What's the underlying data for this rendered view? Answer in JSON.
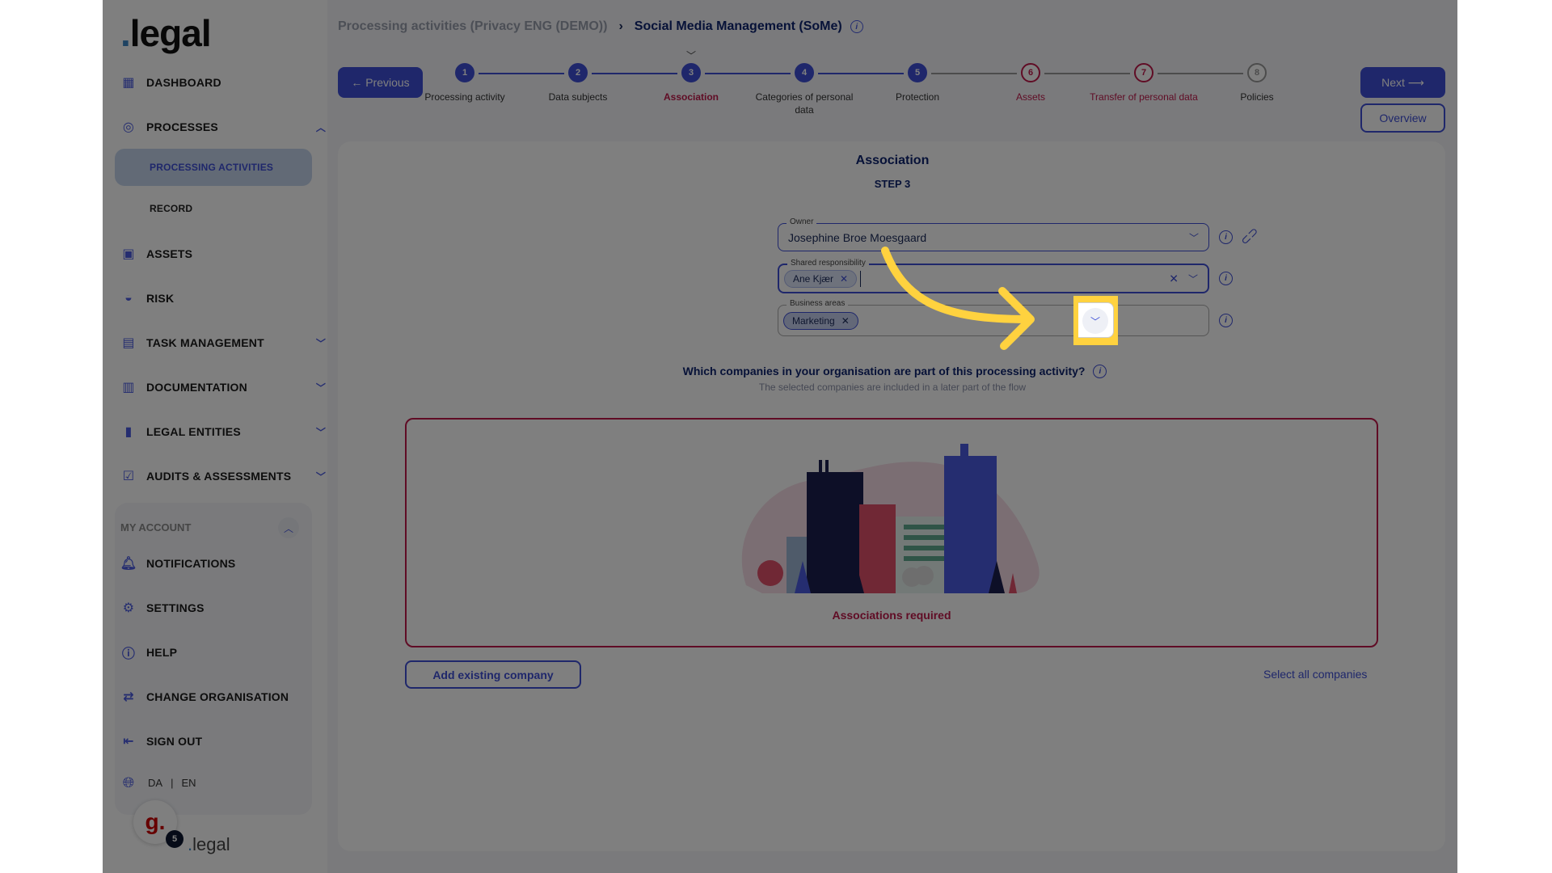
{
  "sidebar": {
    "logo": "legal",
    "items": [
      {
        "label": "DASHBOARD",
        "icon": "dashboard-icon"
      },
      {
        "label": "PROCESSES",
        "icon": "processes-icon",
        "expanded": true
      },
      {
        "label": "ASSETS",
        "icon": "assets-icon"
      },
      {
        "label": "RISK",
        "icon": "gauge-icon"
      },
      {
        "label": "TASK MANAGEMENT",
        "icon": "calendar-edit-icon",
        "expanded": false
      },
      {
        "label": "DOCUMENTATION",
        "icon": "document-upload-icon",
        "expanded": false
      },
      {
        "label": "LEGAL ENTITIES",
        "icon": "buildings-icon",
        "expanded": false
      },
      {
        "label": "AUDITS & ASSESSMENTS",
        "icon": "checklist-icon",
        "expanded": false
      }
    ],
    "sub_items": [
      {
        "label": "PROCESSING ACTIVITIES",
        "active": true
      },
      {
        "label": "RECORD",
        "active": false
      }
    ],
    "account": {
      "title": "MY ACCOUNT",
      "items": [
        {
          "label": "NOTIFICATIONS",
          "icon": "bell-icon"
        },
        {
          "label": "SETTINGS",
          "icon": "gear-icon"
        },
        {
          "label": "HELP",
          "icon": "help-icon"
        },
        {
          "label": "CHANGE ORGANISATION",
          "icon": "switch-icon"
        },
        {
          "label": "SIGN OUT",
          "icon": "sign-out-icon"
        }
      ],
      "lang_da": "DA",
      "lang_sep": "|",
      "lang_en": "EN"
    },
    "g_badge": "g.",
    "g_count": "5",
    "footer_logo": "legal"
  },
  "header": {
    "breadcrumb_parent": "Processing activities (Privacy ENG (DEMO))",
    "breadcrumb_sep": "›",
    "breadcrumb_current": "Social Media Management (SoMe)",
    "prev_label": "← Previous",
    "next_label": "Next ⟶",
    "overview_label": "Overview"
  },
  "stepper": {
    "steps": [
      {
        "num": "1",
        "label": "Processing activity",
        "state": "done"
      },
      {
        "num": "2",
        "label": "Data subjects",
        "state": "done"
      },
      {
        "num": "3",
        "label": "Association",
        "state": "current"
      },
      {
        "num": "4",
        "label": "Categories of personal data",
        "state": "done"
      },
      {
        "num": "5",
        "label": "Protection",
        "state": "done"
      },
      {
        "num": "6",
        "label": "Assets",
        "state": "error"
      },
      {
        "num": "7",
        "label": "Transfer of personal data",
        "state": "error"
      },
      {
        "num": "8",
        "label": "Policies",
        "state": "todo"
      }
    ]
  },
  "form": {
    "title": "Association",
    "step": "STEP 3",
    "owner_label": "Owner",
    "owner_value": "Josephine Broe Moesgaard",
    "shared_label": "Shared responsibility",
    "shared_chip": "Ane Kjær",
    "business_label": "Business areas",
    "business_chip": "Marketing",
    "question": "Which companies in your organisation are part of this processing activity?",
    "question_sub": "The selected companies are included in a later part of the flow",
    "required_text": "Associations required",
    "add_company": "Add existing company",
    "select_all": "Select all companies"
  },
  "colors": {
    "primary": "#3e4fd6",
    "error": "#c0184a",
    "highlight": "#ffd23f",
    "navy": "#0f2470"
  }
}
